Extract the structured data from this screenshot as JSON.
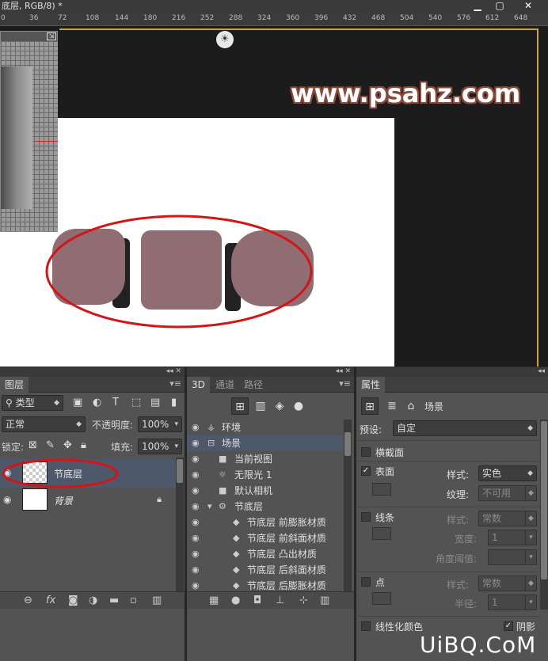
{
  "window": {
    "title": "底层, RGB/8) *",
    "btn_minimize": "▁",
    "btn_restore": "▢",
    "btn_close": "✕"
  },
  "ruler": {
    "ticks": [
      "0",
      "36",
      "72",
      "108",
      "144",
      "180",
      "216",
      "252",
      "288",
      "324",
      "360",
      "396",
      "432",
      "468",
      "504",
      "540",
      "576",
      "612",
      "648"
    ]
  },
  "canvas": {
    "watermark": "www.psahz.com",
    "light_icon": "☀"
  },
  "layers_panel": {
    "tab": "图层",
    "filter_kind": "类型",
    "blend_mode": "正常",
    "opacity_label": "不透明度:",
    "opacity_value": "100%",
    "lock_label": "锁定:",
    "fill_label": "填充:",
    "fill_value": "100%",
    "layers": [
      {
        "name": "节底层",
        "visible": true,
        "selected": true
      },
      {
        "name": "背景",
        "visible": true,
        "locked": true
      }
    ]
  },
  "panel_3d": {
    "tabs": [
      "3D",
      "通道",
      "路径"
    ],
    "tree": [
      {
        "label": "环境",
        "icon": "env-icon",
        "indent": 0
      },
      {
        "label": "场景",
        "icon": "scene-icon",
        "indent": 0,
        "selected": true
      },
      {
        "label": "当前视图",
        "icon": "camera-icon",
        "indent": 1
      },
      {
        "label": "无限光 1",
        "icon": "light-icon",
        "indent": 1
      },
      {
        "label": "默认相机",
        "icon": "camera-icon",
        "indent": 1
      },
      {
        "label": "节底层",
        "icon": "mesh-icon",
        "indent": 1,
        "expanded": true
      },
      {
        "label": "节底层 前膨胀材质",
        "icon": "material-icon",
        "indent": 2
      },
      {
        "label": "节底层 前斜面材质",
        "icon": "material-icon",
        "indent": 2
      },
      {
        "label": "节底层 凸出材质",
        "icon": "material-icon",
        "indent": 2
      },
      {
        "label": "节底层 后斜面材质",
        "icon": "material-icon",
        "indent": 2
      },
      {
        "label": "节底层 后膨胀材质",
        "icon": "material-icon",
        "indent": 2
      }
    ]
  },
  "properties_panel": {
    "tab": "属性",
    "header_label": "场景",
    "preset_label": "预设:",
    "preset_value": "自定",
    "cross_section": "横截面",
    "surface": {
      "label": "表面",
      "checked": true,
      "style_label": "样式:",
      "style_value": "实色",
      "texture_label": "纹理:",
      "texture_value": "不可用"
    },
    "lines": {
      "label": "线条",
      "checked": false,
      "style_label": "样式:",
      "style_value": "常数",
      "width_label": "宽度:",
      "width_value": "1",
      "angle_label": "角度阈值:"
    },
    "points": {
      "label": "点",
      "checked": false,
      "style_label": "样式:",
      "style_value": "常数",
      "radius_label": "半径:",
      "radius_value": "1"
    },
    "linearize": "线性化颜色",
    "shadow": "阴影",
    "shadow_checked": true
  },
  "footer_logo": "UiBQ.CoM"
}
